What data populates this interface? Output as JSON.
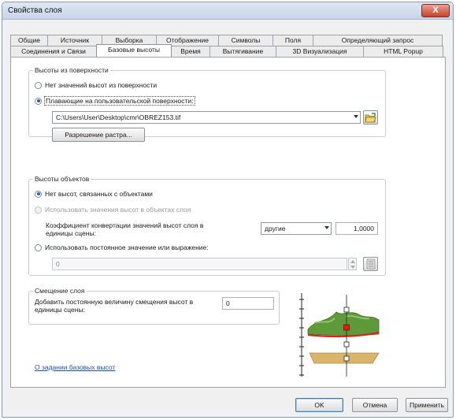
{
  "window": {
    "title": "Свойства слоя",
    "close_label": "X"
  },
  "tabs_row1": [
    "Общие",
    "Источник",
    "Выборка",
    "Отображение",
    "Символы",
    "Поля",
    "Определяющий запрос"
  ],
  "tabs_row2": [
    "Соединения и Связи",
    "Базовые высоты",
    "Время",
    "Вытягивание",
    "3D Визуализация",
    "HTML Popup"
  ],
  "active_tab": "Базовые высоты",
  "surface_group": {
    "legend": "Высоты из поверхности",
    "option_none": "Нет значений высот из поверхности",
    "option_floating": "Плавающие на пользовательской поверхности:",
    "surface_path": "C:\\Users\\User\\Desktop\\cmr\\OBREZ153.tif",
    "resolution_button": "Разрешение растра..."
  },
  "feature_group": {
    "legend": "Высоты объектов",
    "option_none": "Нет высот, связанных с объектами",
    "option_use_values": "Использовать значения высот в объектах слоя",
    "conversion_label": "Коэффициент конвертации значений высот слоя в единицы сцены:",
    "units_select": "другие",
    "conversion_value": "1,0000",
    "option_expression": "Использовать постоянное значение или выражение:",
    "expression_value": "0"
  },
  "offset_group": {
    "legend": "Смещение слоя",
    "label": "Добавить постоянную величину смещения высот в единицы сцены:",
    "value": "0"
  },
  "help_link": "О задании базовых высот",
  "buttons": {
    "ok": "OK",
    "cancel": "Отмена",
    "apply": "Применить"
  },
  "colors": {
    "terrain": "#5f9a3a",
    "curve": "#d8261c",
    "plane": "#d8b56a",
    "marker": "#e11b12"
  }
}
